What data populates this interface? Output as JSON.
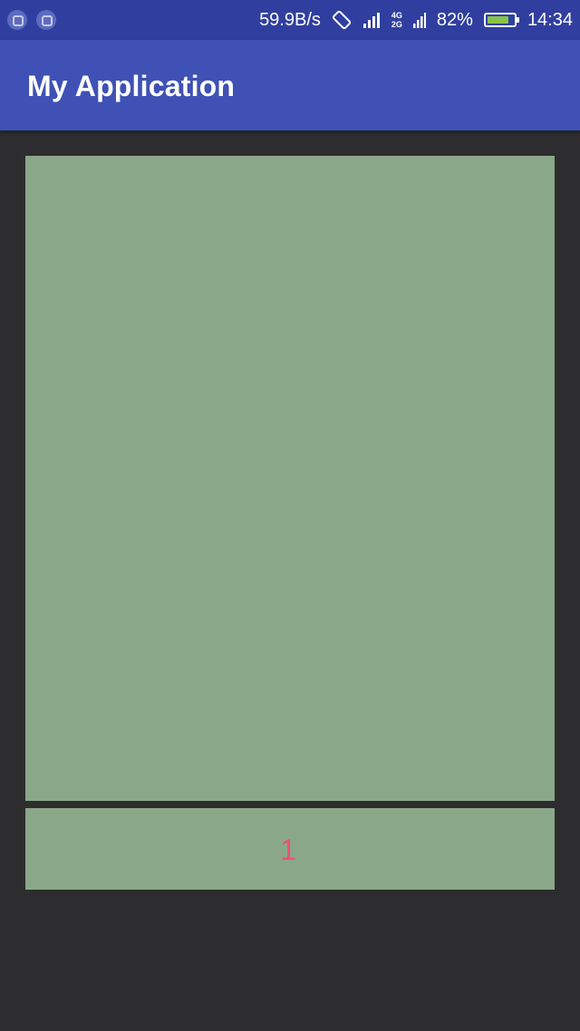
{
  "status_bar": {
    "left_icons": [
      "notification-icon",
      "notification-icon"
    ],
    "net_speed": "59.9B/s",
    "network": {
      "line1": "4G",
      "line2": "2G"
    },
    "battery_percent": "82%",
    "battery_level": 0.82,
    "time": "14:34"
  },
  "app_bar": {
    "title": "My Application"
  },
  "content": {
    "bottom_panel_text": "1"
  },
  "colors": {
    "status_bar": "#303f9f",
    "app_bar": "#3f51b5",
    "background": "#2d2c2e",
    "panel": "#8aa889",
    "accent_text": "#ee4f79"
  }
}
